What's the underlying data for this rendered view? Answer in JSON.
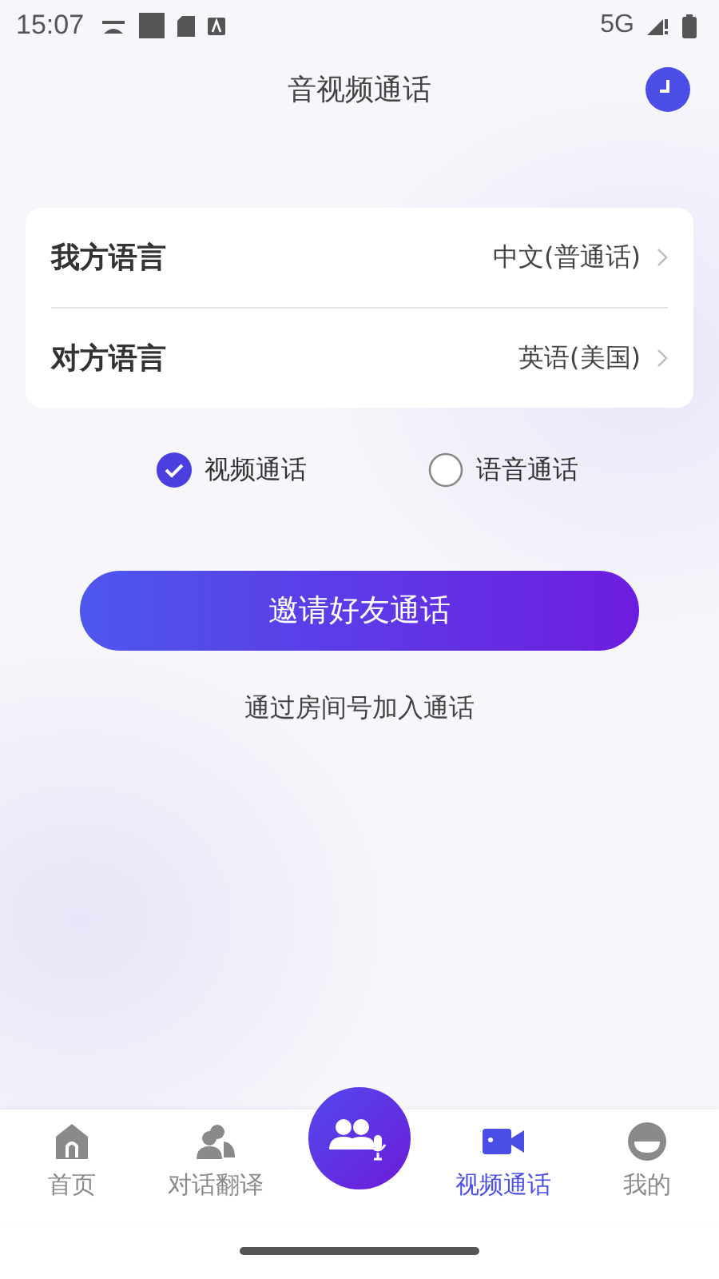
{
  "status_bar": {
    "time": "15:07",
    "network": "5G"
  },
  "header": {
    "title": "音视频通话"
  },
  "language_settings": [
    {
      "label": "我方语言",
      "value": "中文(普通话)"
    },
    {
      "label": "对方语言",
      "value": "英语(美国)"
    }
  ],
  "call_modes": [
    {
      "label": "视频通话",
      "selected": true
    },
    {
      "label": "语音通话",
      "selected": false
    }
  ],
  "invite_button": "邀请好友通话",
  "join_link": "通过房间号加入通话",
  "bottom_nav": [
    {
      "kind": "home",
      "label": "首页",
      "selected": false
    },
    {
      "kind": "dialog",
      "label": "对话翻译",
      "selected": false
    },
    {
      "kind": "center"
    },
    {
      "kind": "video",
      "label": "视频通话",
      "selected": true
    },
    {
      "kind": "profile",
      "label": "我的",
      "selected": false
    }
  ]
}
